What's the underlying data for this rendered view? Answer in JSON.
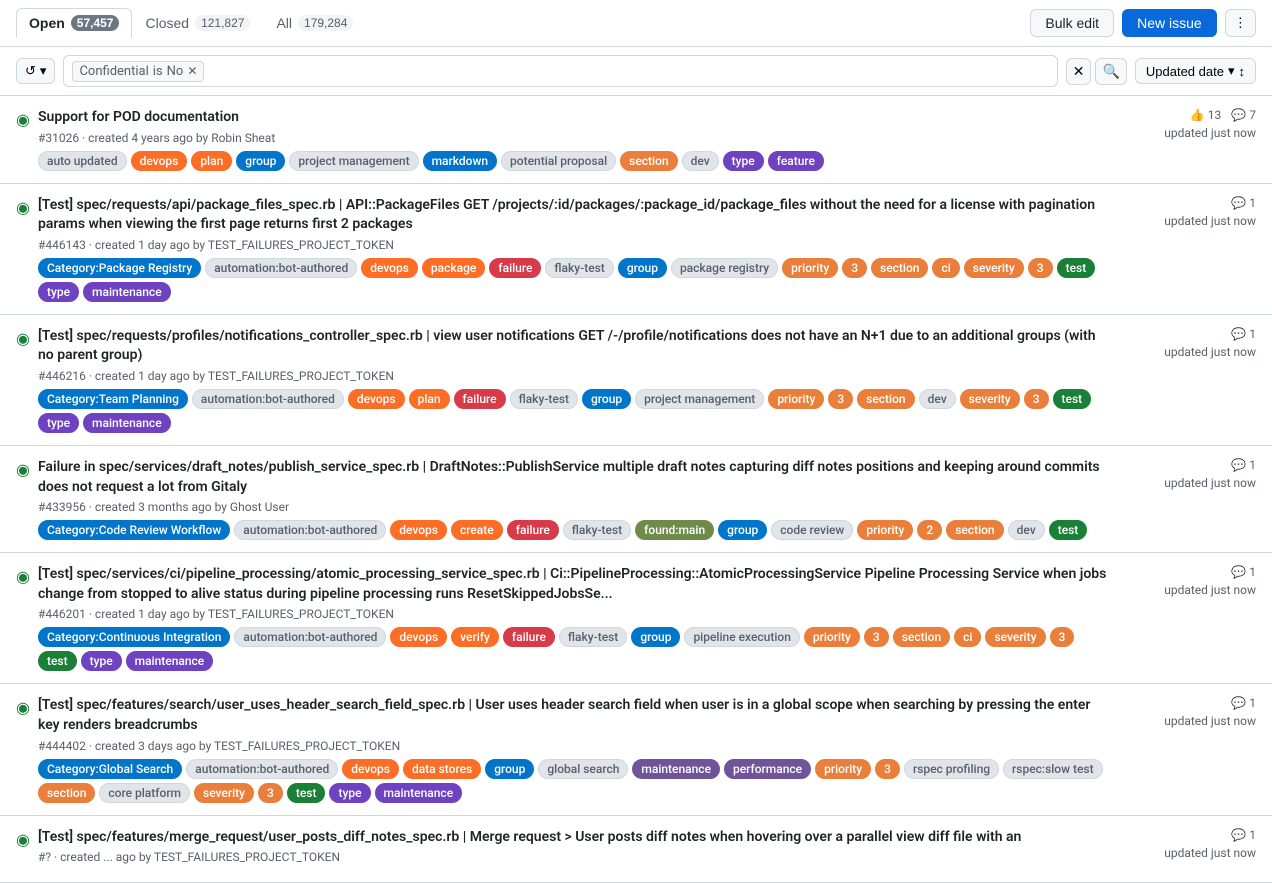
{
  "tabs": [
    {
      "id": "open",
      "label": "Open",
      "count": "57,457",
      "active": true
    },
    {
      "id": "closed",
      "label": "Closed",
      "count": "121,827",
      "active": false
    },
    {
      "id": "all",
      "label": "All",
      "count": "179,284",
      "active": false
    }
  ],
  "toolbar": {
    "bulk_edit_label": "Bulk edit",
    "new_issue_label": "New issue",
    "more_icon": "⋮"
  },
  "filter_bar": {
    "history_icon": "↺",
    "chevron_icon": "▾",
    "filter_tag": {
      "field": "Confidential",
      "operator": "is",
      "value": "No"
    },
    "clear_icon": "✕",
    "search_icon": "🔍",
    "sort_label": "Updated date",
    "sort_icon": "↕"
  },
  "issues": [
    {
      "id": 1,
      "number": "#31026",
      "title": "Support for POD documentation",
      "meta": "created 4 years ago by Robin Sheat",
      "thumbs": "13",
      "comments": "7",
      "updated": "updated just now",
      "labels": [
        {
          "text": "auto updated",
          "bg": "#e1e4e8",
          "color": "#57606a",
          "border": "#d0d7de"
        },
        {
          "text": "devops",
          "bg": "#fc6d26",
          "color": "#fff",
          "border": "#fc6d26"
        },
        {
          "text": "plan",
          "bg": "#fc6d26",
          "color": "#fff",
          "border": "#fc6d26"
        },
        {
          "text": "group",
          "bg": "#0075ca",
          "color": "#fff",
          "border": "#0075ca"
        },
        {
          "text": "project management",
          "bg": "#e1e4e8",
          "color": "#57606a",
          "border": "#d0d7de"
        },
        {
          "text": "markdown",
          "bg": "#0075ca",
          "color": "#fff",
          "border": "#0075ca"
        },
        {
          "text": "potential proposal",
          "bg": "#e1e4e8",
          "color": "#57606a",
          "border": "#d0d7de"
        },
        {
          "text": "section",
          "bg": "#e97f3b",
          "color": "#fff",
          "border": "#e97f3b"
        },
        {
          "text": "dev",
          "bg": "#e1e4e8",
          "color": "#57606a",
          "border": "#d0d7de"
        },
        {
          "text": "type",
          "bg": "#6f42c1",
          "color": "#fff",
          "border": "#6f42c1"
        },
        {
          "text": "feature",
          "bg": "#6f42c1",
          "color": "#fff",
          "border": "#6f42c1"
        }
      ]
    },
    {
      "id": 2,
      "number": "#446143",
      "title": "[Test] spec/requests/api/package_files_spec.rb | API::PackageFiles GET /projects/:id/packages/:package_id/package_files without the need for a license with pagination params when viewing the first page returns first 2 packages",
      "meta": "created 1 day ago by TEST_FAILURES_PROJECT_TOKEN",
      "thumbs": null,
      "comments": "1",
      "updated": "updated just now",
      "labels": [
        {
          "text": "Category:Package Registry",
          "bg": "#0075ca",
          "color": "#fff",
          "border": "#0075ca"
        },
        {
          "text": "automation:bot-authored",
          "bg": "#e1e4e8",
          "color": "#57606a",
          "border": "#d0d7de"
        },
        {
          "text": "devops",
          "bg": "#fc6d26",
          "color": "#fff",
          "border": "#fc6d26"
        },
        {
          "text": "package",
          "bg": "#fc6d26",
          "color": "#fff",
          "border": "#fc6d26"
        },
        {
          "text": "failure",
          "bg": "#d73a49",
          "color": "#fff",
          "border": "#d73a49"
        },
        {
          "text": "flaky-test",
          "bg": "#e1e4e8",
          "color": "#57606a",
          "border": "#d0d7de"
        },
        {
          "text": "group",
          "bg": "#0075ca",
          "color": "#fff",
          "border": "#0075ca"
        },
        {
          "text": "package registry",
          "bg": "#e1e4e8",
          "color": "#57606a",
          "border": "#d0d7de"
        },
        {
          "text": "priority",
          "bg": "#e97f3b",
          "color": "#fff",
          "border": "#e97f3b"
        },
        {
          "text": "3",
          "bg": "#e97f3b",
          "color": "#fff",
          "border": "#e97f3b"
        },
        {
          "text": "section",
          "bg": "#e97f3b",
          "color": "#fff",
          "border": "#e97f3b"
        },
        {
          "text": "ci",
          "bg": "#e97f3b",
          "color": "#fff",
          "border": "#e97f3b"
        },
        {
          "text": "severity",
          "bg": "#e97f3b",
          "color": "#fff",
          "border": "#e97f3b"
        },
        {
          "text": "3",
          "bg": "#e97f3b",
          "color": "#fff",
          "border": "#e97f3b"
        },
        {
          "text": "test",
          "bg": "#1a7f37",
          "color": "#fff",
          "border": "#1a7f37"
        },
        {
          "text": "type",
          "bg": "#6f42c1",
          "color": "#fff",
          "border": "#6f42c1"
        },
        {
          "text": "maintenance",
          "bg": "#6f42c1",
          "color": "#fff",
          "border": "#6f42c1"
        }
      ]
    },
    {
      "id": 3,
      "number": "#446216",
      "title": "[Test] spec/requests/profiles/notifications_controller_spec.rb | view user notifications GET /-/profile/notifications does not have an N+1 due to an additional groups (with no parent group)",
      "meta": "created 1 day ago by TEST_FAILURES_PROJECT_TOKEN",
      "thumbs": null,
      "comments": "1",
      "updated": "updated just now",
      "labels": [
        {
          "text": "Category:Team Planning",
          "bg": "#0075ca",
          "color": "#fff",
          "border": "#0075ca"
        },
        {
          "text": "automation:bot-authored",
          "bg": "#e1e4e8",
          "color": "#57606a",
          "border": "#d0d7de"
        },
        {
          "text": "devops",
          "bg": "#fc6d26",
          "color": "#fff",
          "border": "#fc6d26"
        },
        {
          "text": "plan",
          "bg": "#fc6d26",
          "color": "#fff",
          "border": "#fc6d26"
        },
        {
          "text": "failure",
          "bg": "#d73a49",
          "color": "#fff",
          "border": "#d73a49"
        },
        {
          "text": "flaky-test",
          "bg": "#e1e4e8",
          "color": "#57606a",
          "border": "#d0d7de"
        },
        {
          "text": "group",
          "bg": "#0075ca",
          "color": "#fff",
          "border": "#0075ca"
        },
        {
          "text": "project management",
          "bg": "#e1e4e8",
          "color": "#57606a",
          "border": "#d0d7de"
        },
        {
          "text": "priority",
          "bg": "#e97f3b",
          "color": "#fff",
          "border": "#e97f3b"
        },
        {
          "text": "3",
          "bg": "#e97f3b",
          "color": "#fff",
          "border": "#e97f3b"
        },
        {
          "text": "section",
          "bg": "#e97f3b",
          "color": "#fff",
          "border": "#e97f3b"
        },
        {
          "text": "dev",
          "bg": "#e1e4e8",
          "color": "#57606a",
          "border": "#d0d7de"
        },
        {
          "text": "severity",
          "bg": "#e97f3b",
          "color": "#fff",
          "border": "#e97f3b"
        },
        {
          "text": "3",
          "bg": "#e97f3b",
          "color": "#fff",
          "border": "#e97f3b"
        },
        {
          "text": "test",
          "bg": "#1a7f37",
          "color": "#fff",
          "border": "#1a7f37"
        },
        {
          "text": "type",
          "bg": "#6f42c1",
          "color": "#fff",
          "border": "#6f42c1"
        },
        {
          "text": "maintenance",
          "bg": "#6f42c1",
          "color": "#fff",
          "border": "#6f42c1"
        }
      ]
    },
    {
      "id": 4,
      "number": "#433956",
      "title": "Failure in spec/services/draft_notes/publish_service_spec.rb | DraftNotes::PublishService multiple draft notes capturing diff notes positions and keeping around commits does not request a lot from Gitaly",
      "meta": "created 3 months ago by Ghost User",
      "thumbs": null,
      "comments": "1",
      "updated": "updated just now",
      "labels": [
        {
          "text": "Category:Code Review Workflow",
          "bg": "#0075ca",
          "color": "#fff",
          "border": "#0075ca"
        },
        {
          "text": "automation:bot-authored",
          "bg": "#e1e4e8",
          "color": "#57606a",
          "border": "#d0d7de"
        },
        {
          "text": "devops",
          "bg": "#fc6d26",
          "color": "#fff",
          "border": "#fc6d26"
        },
        {
          "text": "create",
          "bg": "#fc6d26",
          "color": "#fff",
          "border": "#fc6d26"
        },
        {
          "text": "failure",
          "bg": "#d73a49",
          "color": "#fff",
          "border": "#d73a49"
        },
        {
          "text": "flaky-test",
          "bg": "#e1e4e8",
          "color": "#57606a",
          "border": "#d0d7de"
        },
        {
          "text": "found:main",
          "bg": "#6f8b4b",
          "color": "#fff",
          "border": "#6f8b4b"
        },
        {
          "text": "group",
          "bg": "#0075ca",
          "color": "#fff",
          "border": "#0075ca"
        },
        {
          "text": "code review",
          "bg": "#e1e4e8",
          "color": "#57606a",
          "border": "#d0d7de"
        },
        {
          "text": "priority",
          "bg": "#e97f3b",
          "color": "#fff",
          "border": "#e97f3b"
        },
        {
          "text": "2",
          "bg": "#e97f3b",
          "color": "#fff",
          "border": "#e97f3b"
        },
        {
          "text": "section",
          "bg": "#e97f3b",
          "color": "#fff",
          "border": "#e97f3b"
        },
        {
          "text": "dev",
          "bg": "#e1e4e8",
          "color": "#57606a",
          "border": "#d0d7de"
        },
        {
          "text": "test",
          "bg": "#1a7f37",
          "color": "#fff",
          "border": "#1a7f37"
        }
      ]
    },
    {
      "id": 5,
      "number": "#446201",
      "title": "[Test] spec/services/ci/pipeline_processing/atomic_processing_service_spec.rb | Ci::PipelineProcessing::AtomicProcessingService Pipeline Processing Service when jobs change from stopped to alive status during pipeline processing runs ResetSkippedJobsSe...",
      "meta": "created 1 day ago by TEST_FAILURES_PROJECT_TOKEN",
      "thumbs": null,
      "comments": "1",
      "updated": "updated just now",
      "labels": [
        {
          "text": "Category:Continuous Integration",
          "bg": "#0075ca",
          "color": "#fff",
          "border": "#0075ca"
        },
        {
          "text": "automation:bot-authored",
          "bg": "#e1e4e8",
          "color": "#57606a",
          "border": "#d0d7de"
        },
        {
          "text": "devops",
          "bg": "#fc6d26",
          "color": "#fff",
          "border": "#fc6d26"
        },
        {
          "text": "verify",
          "bg": "#fc6d26",
          "color": "#fff",
          "border": "#fc6d26"
        },
        {
          "text": "failure",
          "bg": "#d73a49",
          "color": "#fff",
          "border": "#d73a49"
        },
        {
          "text": "flaky-test",
          "bg": "#e1e4e8",
          "color": "#57606a",
          "border": "#d0d7de"
        },
        {
          "text": "group",
          "bg": "#0075ca",
          "color": "#fff",
          "border": "#0075ca"
        },
        {
          "text": "pipeline execution",
          "bg": "#e1e4e8",
          "color": "#57606a",
          "border": "#d0d7de"
        },
        {
          "text": "priority",
          "bg": "#e97f3b",
          "color": "#fff",
          "border": "#e97f3b"
        },
        {
          "text": "3",
          "bg": "#e97f3b",
          "color": "#fff",
          "border": "#e97f3b"
        },
        {
          "text": "section",
          "bg": "#e97f3b",
          "color": "#fff",
          "border": "#e97f3b"
        },
        {
          "text": "ci",
          "bg": "#e97f3b",
          "color": "#fff",
          "border": "#e97f3b"
        },
        {
          "text": "severity",
          "bg": "#e97f3b",
          "color": "#fff",
          "border": "#e97f3b"
        },
        {
          "text": "3",
          "bg": "#e97f3b",
          "color": "#fff",
          "border": "#e97f3b"
        },
        {
          "text": "test",
          "bg": "#1a7f37",
          "color": "#fff",
          "border": "#1a7f37"
        },
        {
          "text": "type",
          "bg": "#6f42c1",
          "color": "#fff",
          "border": "#6f42c1"
        },
        {
          "text": "maintenance",
          "bg": "#6f42c1",
          "color": "#fff",
          "border": "#6f42c1"
        }
      ]
    },
    {
      "id": 6,
      "number": "#444402",
      "title": "[Test] spec/features/search/user_uses_header_search_field_spec.rb | User uses header search field when user is in a global scope when searching by pressing the enter key renders breadcrumbs",
      "meta": "created 3 days ago by TEST_FAILURES_PROJECT_TOKEN",
      "thumbs": null,
      "comments": "1",
      "updated": "updated just now",
      "labels": [
        {
          "text": "Category:Global Search",
          "bg": "#0075ca",
          "color": "#fff",
          "border": "#0075ca"
        },
        {
          "text": "automation:bot-authored",
          "bg": "#e1e4e8",
          "color": "#57606a",
          "border": "#d0d7de"
        },
        {
          "text": "devops",
          "bg": "#fc6d26",
          "color": "#fff",
          "border": "#fc6d26"
        },
        {
          "text": "data stores",
          "bg": "#fc6d26",
          "color": "#fff",
          "border": "#fc6d26"
        },
        {
          "text": "group",
          "bg": "#0075ca",
          "color": "#fff",
          "border": "#0075ca"
        },
        {
          "text": "global search",
          "bg": "#e1e4e8",
          "color": "#57606a",
          "border": "#d0d7de"
        },
        {
          "text": "maintenance",
          "bg": "#6f5499",
          "color": "#fff",
          "border": "#6f5499"
        },
        {
          "text": "performance",
          "bg": "#6f5499",
          "color": "#fff",
          "border": "#6f5499"
        },
        {
          "text": "priority",
          "bg": "#e97f3b",
          "color": "#fff",
          "border": "#e97f3b"
        },
        {
          "text": "3",
          "bg": "#e97f3b",
          "color": "#fff",
          "border": "#e97f3b"
        },
        {
          "text": "rspec profiling",
          "bg": "#e1e4e8",
          "color": "#57606a",
          "border": "#d0d7de"
        },
        {
          "text": "rspec:slow test",
          "bg": "#e1e4e8",
          "color": "#57606a",
          "border": "#d0d7de"
        },
        {
          "text": "section",
          "bg": "#e97f3b",
          "color": "#fff",
          "border": "#e97f3b"
        },
        {
          "text": "core platform",
          "bg": "#e1e4e8",
          "color": "#57606a",
          "border": "#d0d7de"
        },
        {
          "text": "severity",
          "bg": "#e97f3b",
          "color": "#fff",
          "border": "#e97f3b"
        },
        {
          "text": "3",
          "bg": "#e97f3b",
          "color": "#fff",
          "border": "#e97f3b"
        },
        {
          "text": "test",
          "bg": "#1a7f37",
          "color": "#fff",
          "border": "#1a7f37"
        },
        {
          "text": "type",
          "bg": "#6f42c1",
          "color": "#fff",
          "border": "#6f42c1"
        },
        {
          "text": "maintenance",
          "bg": "#6f42c1",
          "color": "#fff",
          "border": "#6f42c1"
        }
      ]
    },
    {
      "id": 7,
      "number": "#?",
      "title": "[Test] spec/features/merge_request/user_posts_diff_notes_spec.rb | Merge request > User posts diff notes when hovering over a parallel view diff file with an",
      "meta": "created ... ago by TEST_FAILURES_PROJECT_TOKEN",
      "thumbs": null,
      "comments": "1",
      "updated": "updated just now",
      "labels": []
    }
  ]
}
